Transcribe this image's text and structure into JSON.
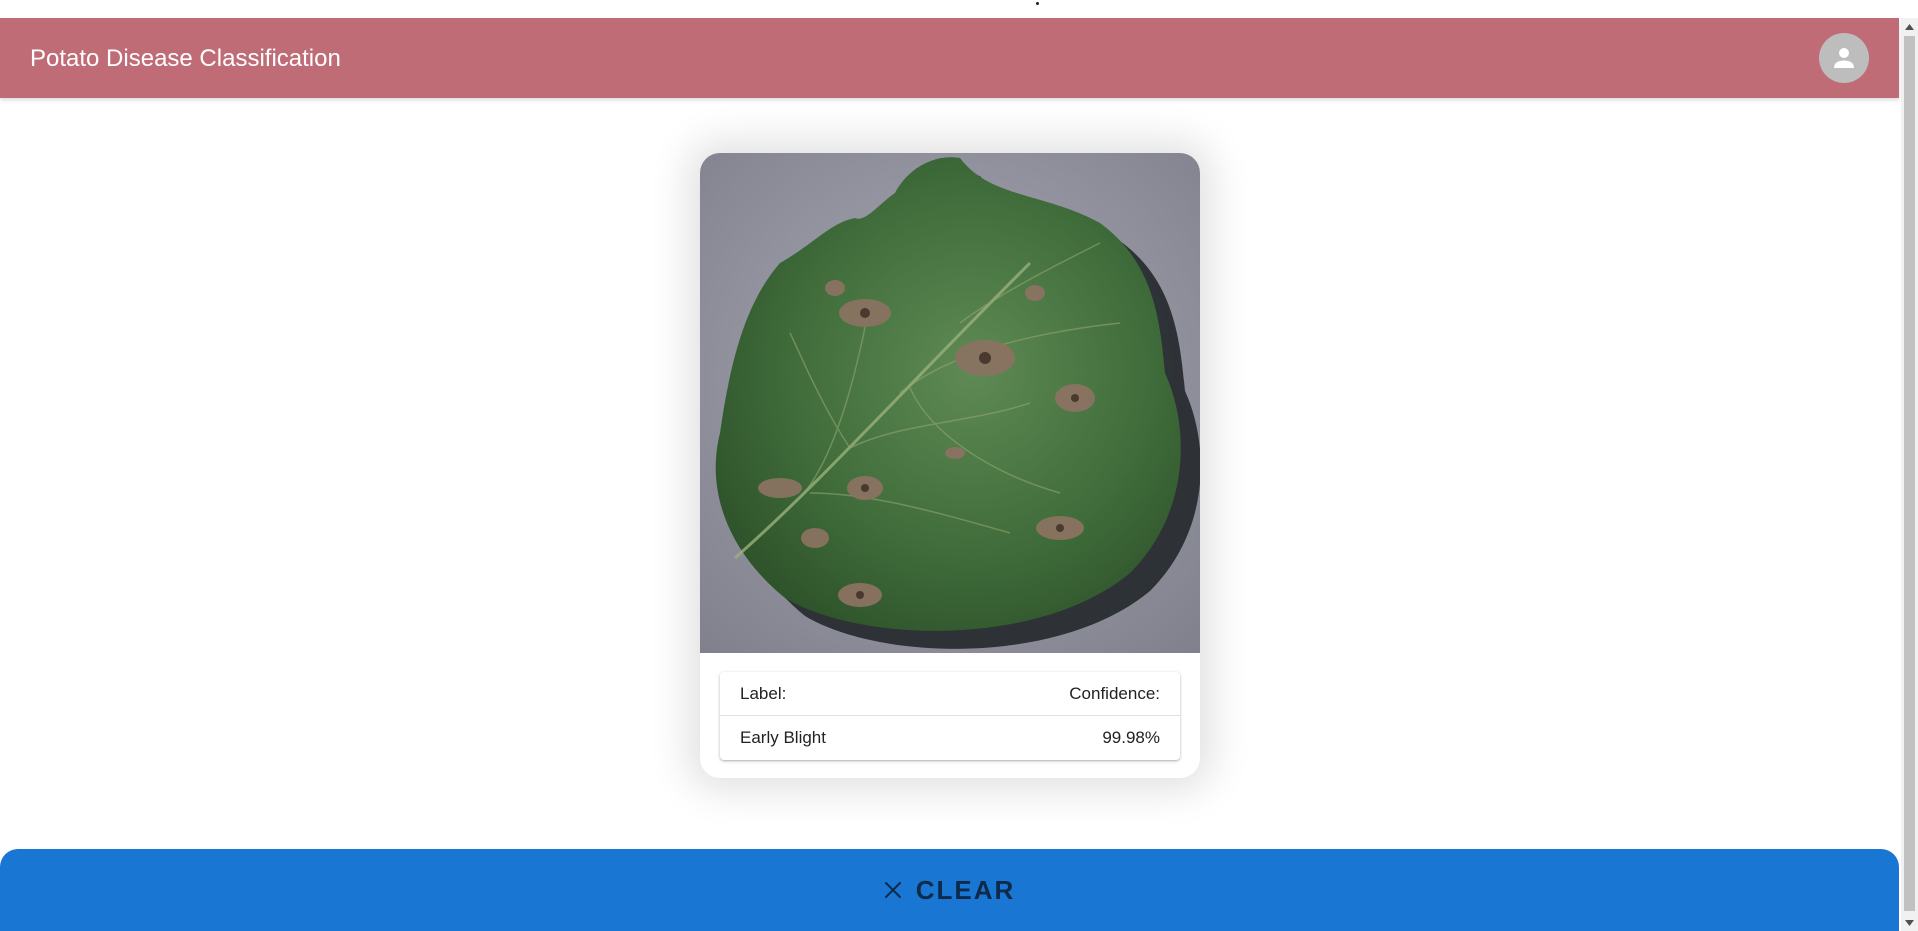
{
  "app": {
    "title": "Potato Disease Classification"
  },
  "result": {
    "headers": {
      "label": "Label:",
      "confidence": "Confidence:"
    },
    "label": "Early Blight",
    "confidence": "99.98%"
  },
  "actions": {
    "clear_label": "CLEAR"
  },
  "icons": {
    "avatar": "person-icon",
    "clear": "close-icon"
  },
  "colors": {
    "header_bg": "#c06c77",
    "clear_bg": "#1976d2",
    "clear_text": "#0d2a4a"
  }
}
